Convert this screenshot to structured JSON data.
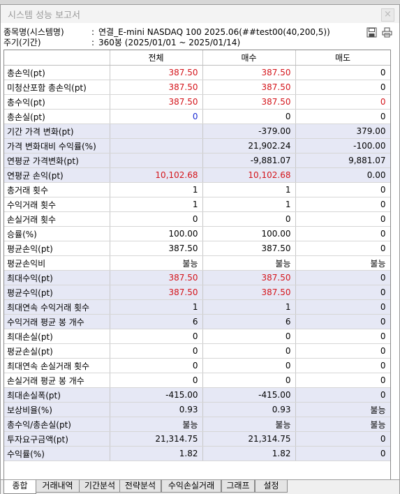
{
  "window": {
    "title": "시스템 성능 보고서",
    "close_label": "×"
  },
  "info": {
    "symbol_label": "종목명(시스템명)",
    "symbol_value": "연결_E-mini NASDAQ 100 2025.06(##test00(40,200,5))",
    "period_label": "주기(기간)",
    "period_value": "360봉 (2025/01/01 ~ 2025/01/14)",
    "colon": ":"
  },
  "toolbar": {
    "save_icon": "save-icon",
    "print_icon": "print-icon"
  },
  "table": {
    "headers": [
      "",
      "전체",
      "매수",
      "매도"
    ],
    "rows": [
      {
        "label": "총손익(pt)",
        "cells": [
          "387.50",
          "387.50",
          "0"
        ],
        "colors": [
          "red",
          "red",
          ""
        ],
        "shaded": false
      },
      {
        "label": "미청산포함 총손익(pt)",
        "cells": [
          "387.50",
          "387.50",
          "0"
        ],
        "colors": [
          "red",
          "red",
          ""
        ],
        "shaded": false
      },
      {
        "label": "총수익(pt)",
        "cells": [
          "387.50",
          "387.50",
          "0"
        ],
        "colors": [
          "red",
          "red",
          "red"
        ],
        "shaded": false
      },
      {
        "label": "총손실(pt)",
        "cells": [
          "0",
          "0",
          "0"
        ],
        "colors": [
          "blue",
          "",
          ""
        ],
        "shaded": false
      },
      {
        "label": "기간 가격 변화(pt)",
        "cells": [
          "",
          "-379.00",
          "379.00"
        ],
        "colors": [
          "",
          "",
          ""
        ],
        "shaded": true
      },
      {
        "label": "가격 변화대비 수익률(%)",
        "cells": [
          "",
          "21,902.24",
          "-100.00"
        ],
        "colors": [
          "",
          "",
          ""
        ],
        "shaded": true
      },
      {
        "label": "연평균 가격변화(pt)",
        "cells": [
          "",
          "-9,881.07",
          "9,881.07"
        ],
        "colors": [
          "",
          "",
          ""
        ],
        "shaded": true
      },
      {
        "label": "연평균 손익(pt)",
        "cells": [
          "10,102.68",
          "10,102.68",
          "0.00"
        ],
        "colors": [
          "red",
          "red",
          ""
        ],
        "shaded": true
      },
      {
        "label": "총거래 횟수",
        "cells": [
          "1",
          "1",
          "0"
        ],
        "colors": [
          "",
          "",
          ""
        ],
        "shaded": false
      },
      {
        "label": "수익거래 횟수",
        "cells": [
          "1",
          "1",
          "0"
        ],
        "colors": [
          "",
          "",
          ""
        ],
        "shaded": false
      },
      {
        "label": "손실거래 횟수",
        "cells": [
          "0",
          "0",
          "0"
        ],
        "colors": [
          "",
          "",
          ""
        ],
        "shaded": false
      },
      {
        "label": "승률(%)",
        "cells": [
          "100.00",
          "100.00",
          "0"
        ],
        "colors": [
          "",
          "",
          ""
        ],
        "shaded": false
      },
      {
        "label": "평균손익(pt)",
        "cells": [
          "387.50",
          "387.50",
          "0"
        ],
        "colors": [
          "",
          "",
          ""
        ],
        "shaded": false
      },
      {
        "label": "평균손익비",
        "cells": [
          "불능",
          "불능",
          "불능"
        ],
        "colors": [
          "",
          "",
          ""
        ],
        "shaded": false
      },
      {
        "label": "최대수익(pt)",
        "cells": [
          "387.50",
          "387.50",
          "0"
        ],
        "colors": [
          "red",
          "red",
          ""
        ],
        "shaded": true
      },
      {
        "label": "평균수익(pt)",
        "cells": [
          "387.50",
          "387.50",
          "0"
        ],
        "colors": [
          "red",
          "red",
          ""
        ],
        "shaded": true
      },
      {
        "label": "최대연속 수익거래 횟수",
        "cells": [
          "1",
          "1",
          "0"
        ],
        "colors": [
          "",
          "",
          ""
        ],
        "shaded": true
      },
      {
        "label": "수익거래 평균 봉 개수",
        "cells": [
          "6",
          "6",
          "0"
        ],
        "colors": [
          "",
          "",
          ""
        ],
        "shaded": true
      },
      {
        "label": "최대손실(pt)",
        "cells": [
          "0",
          "0",
          "0"
        ],
        "colors": [
          "",
          "",
          ""
        ],
        "shaded": false
      },
      {
        "label": "평균손실(pt)",
        "cells": [
          "0",
          "0",
          "0"
        ],
        "colors": [
          "",
          "",
          ""
        ],
        "shaded": false
      },
      {
        "label": "최대연속 손실거래 횟수",
        "cells": [
          "0",
          "0",
          "0"
        ],
        "colors": [
          "",
          "",
          ""
        ],
        "shaded": false
      },
      {
        "label": "손실거래 평균 봉 개수",
        "cells": [
          "0",
          "0",
          "0"
        ],
        "colors": [
          "",
          "",
          ""
        ],
        "shaded": false
      },
      {
        "label": "최대손실폭(pt)",
        "cells": [
          "-415.00",
          "-415.00",
          "0"
        ],
        "colors": [
          "",
          "",
          ""
        ],
        "shaded": true
      },
      {
        "label": "보상비율(%)",
        "cells": [
          "0.93",
          "0.93",
          "불능"
        ],
        "colors": [
          "",
          "",
          ""
        ],
        "shaded": true
      },
      {
        "label": "총수익/총손실(pt)",
        "cells": [
          "불능",
          "불능",
          "불능"
        ],
        "colors": [
          "",
          "",
          ""
        ],
        "shaded": true
      },
      {
        "label": "투자요구금액(pt)",
        "cells": [
          "21,314.75",
          "21,314.75",
          "0"
        ],
        "colors": [
          "",
          "",
          ""
        ],
        "shaded": true
      },
      {
        "label": "수익률(%)",
        "cells": [
          "1.82",
          "1.82",
          "0"
        ],
        "colors": [
          "",
          "",
          ""
        ],
        "shaded": true
      }
    ]
  },
  "tabs": [
    {
      "label": "종합",
      "active": true
    },
    {
      "label": "거래내역",
      "active": false
    },
    {
      "label": "기간분석",
      "active": false
    },
    {
      "label": "전략분석",
      "active": false
    },
    {
      "label": "수익손실거래",
      "active": false
    },
    {
      "label": "그래프",
      "active": false
    },
    {
      "label": "설정",
      "active": false
    }
  ],
  "colors": {
    "red": "#d4141a",
    "blue": "#1a2ad4",
    "shaded_row": "#e6e8f5"
  }
}
